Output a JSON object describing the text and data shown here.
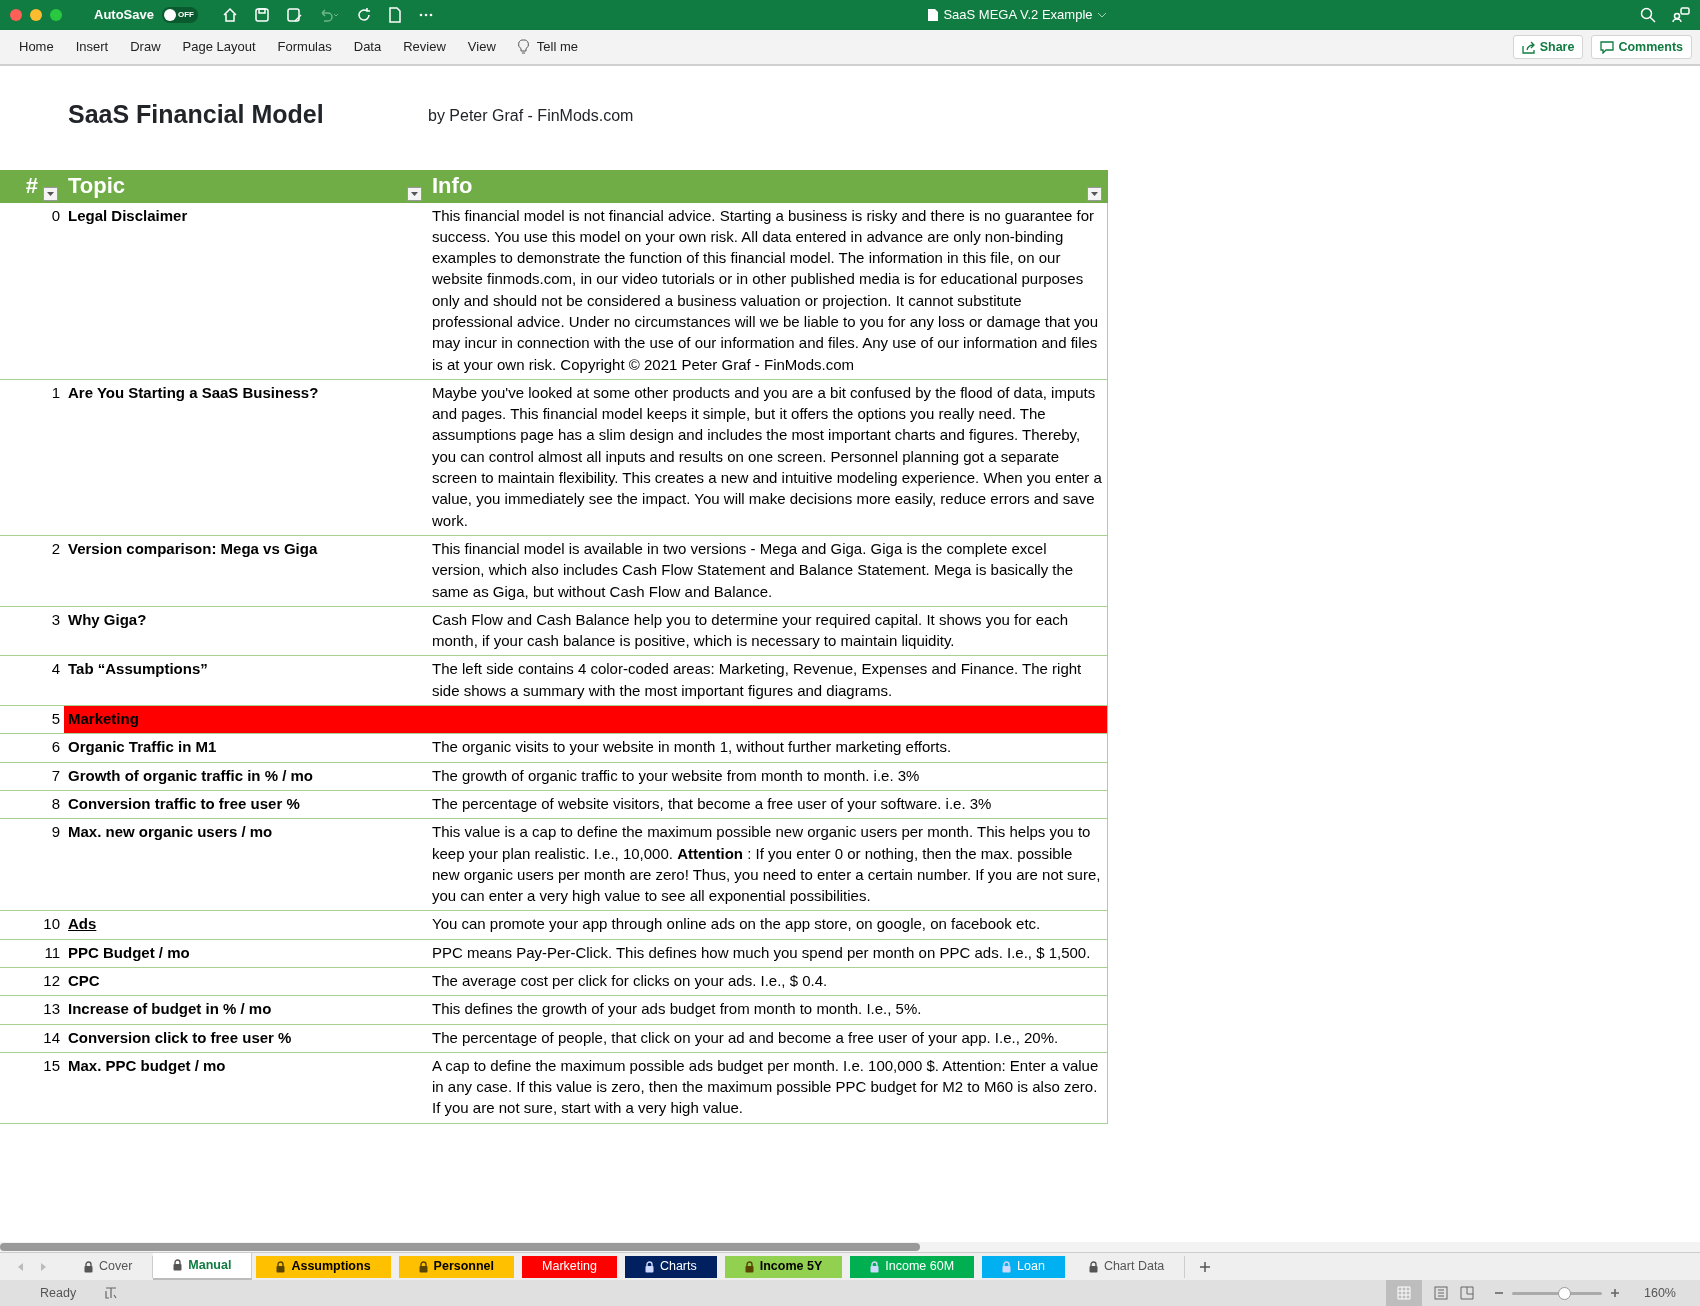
{
  "window": {
    "title": "SaaS MEGA V.2 Example",
    "autosave": {
      "label": "AutoSave",
      "state": "OFF",
      "on": false
    }
  },
  "ribbon": {
    "tabs": [
      "Home",
      "Insert",
      "Draw",
      "Page Layout",
      "Formulas",
      "Data",
      "Review",
      "View"
    ],
    "tell_me": "Tell me",
    "share": "Share",
    "comments": "Comments"
  },
  "sheet": {
    "title": "SaaS Financial Model",
    "byline": "by Peter Graf - FinMods.com",
    "columns": [
      "#",
      "Topic",
      "Info"
    ],
    "rows": [
      {
        "num": "0",
        "topic": "Legal Disclaimer",
        "info": "This financial model is not financial advice. Starting a business is risky and there is no guarantee for success. You use this model on your own risk. All data entered in advance are only non-binding examples to demonstrate the function of this financial model. The information in this file, on our website finmods.com, in our video tutorials or in other published media is for educational purposes only and should not be considered a business valuation or projection. It cannot substitute professional advice. Under no circumstances will we be liable to you for any loss or damage that you may incur in connection with the use of our information and files. Any use of our information and files is at your own risk. Copyright © 2021 Peter Graf - FinMods.com"
      },
      {
        "num": "1",
        "topic": "Are You Starting a SaaS Business?",
        "info": "Maybe you've looked at some other products and you are a bit confused by the flood of data, imputs and pages. This financial model keeps it simple, but it offers the options you really need. The assumptions page has a slim design and includes the most important charts and figures. Thereby, you can control almost all inputs and results on one screen. Personnel planning got a separate screen to maintain flexibility. This creates a new and intuitive modeling experience. When you enter a value, you immediately see the impact. You will make decisions more easily, reduce errors and save work."
      },
      {
        "num": "2",
        "topic": "Version comparison: Mega vs Giga",
        "info": "This financial model is available in two versions - Mega and Giga. Giga is the complete excel version, which also includes Cash Flow Statement and Balance Statement. Mega is basically the same as Giga, but without Cash Flow and Balance."
      },
      {
        "num": "3",
        "topic": "Why Giga?",
        "info": "Cash Flow and Cash Balance help you to determine your required capital. It shows you for each month, if your cash balance is positive, which is necessary to maintain liquidity."
      },
      {
        "num": "4",
        "topic": "Tab “Assumptions”",
        "info": "The left side contains 4 color-coded areas: Marketing, Revenue, Expenses and Finance. The right side shows a summary with the most important figures and diagrams."
      },
      {
        "num": "5",
        "topic": "Marketing",
        "highlight": true
      },
      {
        "num": "6",
        "topic": "Organic Traffic in M1",
        "info": "The organic visits to your website in month 1, without further marketing efforts."
      },
      {
        "num": "7",
        "topic": "Growth of organic traffic in % / mo",
        "info": "The growth of organic traffic to your website from month to month. i.e. 3%"
      },
      {
        "num": "8",
        "topic": "Conversion traffic to free user %",
        "info": "The percentage of website visitors, that become a free user of your software. i.e. 3%"
      },
      {
        "num": "9",
        "topic": "Max. new organic users / mo",
        "info": "This value is a cap to define the maximum possible new organic users per month. This helps you to keep your plan realistic. I.e., 10,000. **Attention** : If you enter 0 or nothing, then the max. possible new organic users per month are zero! Thus, you need to enter a certain number. If you are not sure, you can enter a very high value to see all exponential possibilities."
      },
      {
        "num": "10",
        "topic": "Ads",
        "underlined": true,
        "info": "You can promote your app through online ads on the app store, on google, on facebook etc."
      },
      {
        "num": "11",
        "topic": "PPC Budget / mo",
        "info": "PPC means Pay-Per-Click. This defines how much you spend per month on PPC ads. I.e., $ 1,500."
      },
      {
        "num": "12",
        "topic": "CPC",
        "info": "The average cost per click for clicks on your ads. I.e., $ 0.4."
      },
      {
        "num": "13",
        "topic": "Increase of budget in % / mo",
        "info": "This defines the growth of your ads budget from month to month. I.e., 5%."
      },
      {
        "num": "14",
        "topic": "Conversion click to free user %",
        "info": "The percentage of people, that click on your ad and become a free user of your app. I.e., 20%."
      },
      {
        "num": "15",
        "topic": "Max. PPC budget / mo",
        "info": "A cap to define the maximum possible ads budget per month. I.e. 100,000 $. Attention: Enter a value in any case. If this value is zero, then the maximum possible PPC budget for M2 to M60 is also zero. If you are not sure, start with a very high value."
      }
    ]
  },
  "sheet_tabs": [
    {
      "label": "Cover",
      "locked": true,
      "selected": false
    },
    {
      "label": "Manual",
      "locked": true,
      "selected": true
    },
    {
      "label": "Assumptions",
      "locked": true,
      "selected": false,
      "color": "#ffc000"
    },
    {
      "label": "Personnel",
      "locked": true,
      "selected": false,
      "color": "#ffc000"
    },
    {
      "label": "Marketing",
      "locked": false,
      "selected": false,
      "color": "#ff0000"
    },
    {
      "label": "Charts",
      "locked": true,
      "selected": false,
      "color": "#002060"
    },
    {
      "label": "Income 5Y",
      "locked": true,
      "selected": false,
      "color": "#92d050"
    },
    {
      "label": "Income 60M",
      "locked": true,
      "selected": false,
      "color": "#00b050"
    },
    {
      "label": "Loan",
      "locked": true,
      "selected": false,
      "color": "#00b0f0"
    },
    {
      "label": "Chart Data",
      "locked": true,
      "selected": false
    }
  ],
  "status_bar": {
    "status": "Ready",
    "zoom": {
      "level": 0.58,
      "reading": "160%"
    }
  }
}
